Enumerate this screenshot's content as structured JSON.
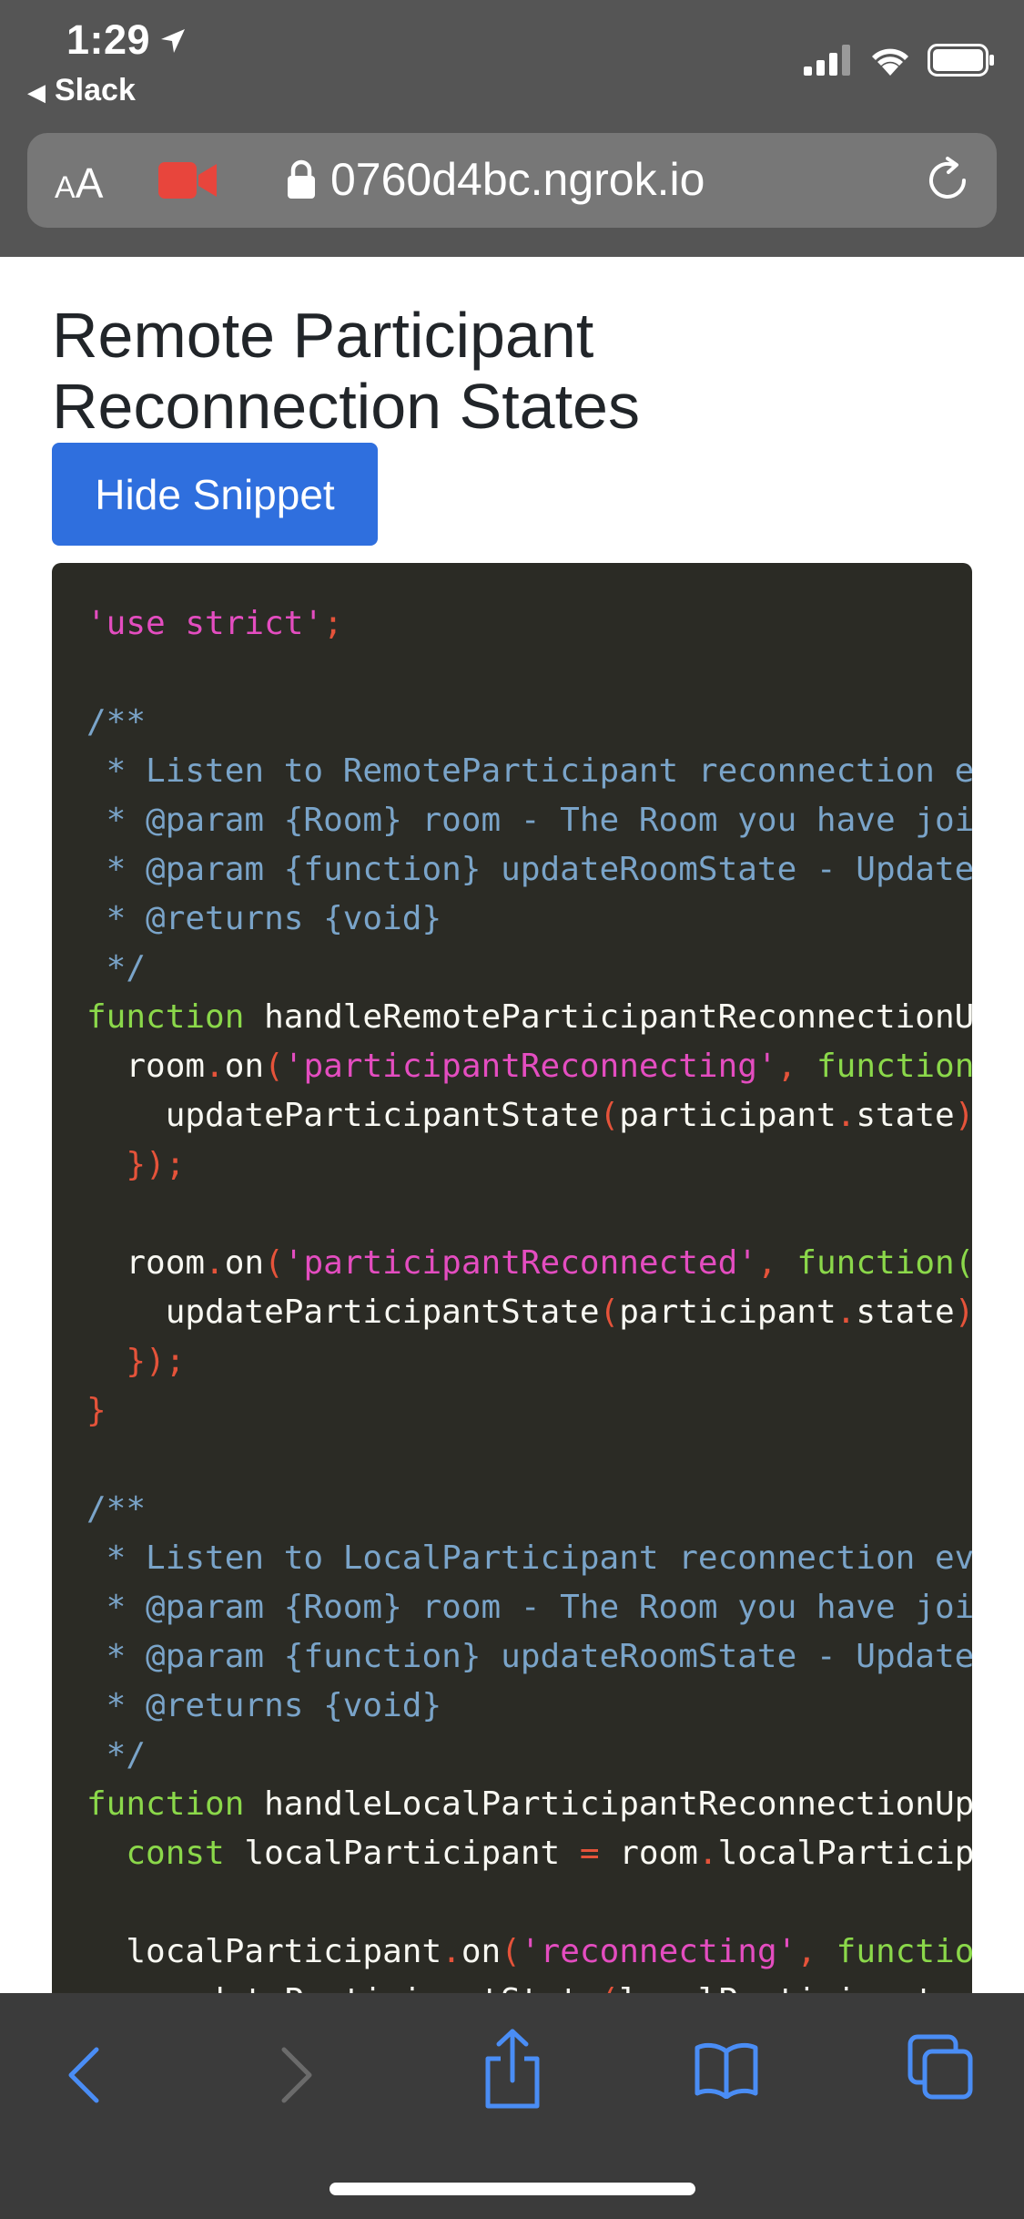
{
  "status_bar": {
    "time": "1:29",
    "back_app": "Slack"
  },
  "browser": {
    "text_size_label_small": "A",
    "text_size_label_big": "A",
    "url": "0760d4bc.ngrok.io"
  },
  "page": {
    "title": "Remote Participant Reconnection States",
    "hide_button": "Hide Snippet"
  },
  "code_lines": [
    [
      {
        "t": "'use strict'",
        "c": "str"
      },
      {
        "t": ";",
        "c": "punc"
      }
    ],
    [],
    [
      {
        "t": "/**",
        "c": "cm"
      }
    ],
    [
      {
        "t": " * Listen to RemoteParticipant reconnection ev",
        "c": "cm"
      }
    ],
    [
      {
        "t": " * @param {Room} room - The Room you have joi",
        "c": "cm"
      }
    ],
    [
      {
        "t": " * @param {function} updateRoomState - Update",
        "c": "cm"
      }
    ],
    [
      {
        "t": " * @returns {void}",
        "c": "cm"
      }
    ],
    [
      {
        "t": " */",
        "c": "cm"
      }
    ],
    [
      {
        "t": "function",
        "c": "kw"
      },
      {
        "t": " handleRemoteParticipantReconnectionU",
        "c": "pl"
      }
    ],
    [
      {
        "t": "  room",
        "c": "pl"
      },
      {
        "t": ".",
        "c": "punc"
      },
      {
        "t": "on",
        "c": "pl"
      },
      {
        "t": "(",
        "c": "punc"
      },
      {
        "t": "'participantReconnecting'",
        "c": "str"
      },
      {
        "t": ", ",
        "c": "punc"
      },
      {
        "t": "function",
        "c": "kw"
      }
    ],
    [
      {
        "t": "    updateParticipantState",
        "c": "pl"
      },
      {
        "t": "(",
        "c": "punc"
      },
      {
        "t": "participant",
        "c": "pl"
      },
      {
        "t": ".",
        "c": "punc"
      },
      {
        "t": "state",
        "c": "pl"
      },
      {
        "t": ")",
        "c": "punc"
      }
    ],
    [
      {
        "t": "  });",
        "c": "punc"
      }
    ],
    [],
    [
      {
        "t": "  room",
        "c": "pl"
      },
      {
        "t": ".",
        "c": "punc"
      },
      {
        "t": "on",
        "c": "pl"
      },
      {
        "t": "(",
        "c": "punc"
      },
      {
        "t": "'participantReconnected'",
        "c": "str"
      },
      {
        "t": ", ",
        "c": "punc"
      },
      {
        "t": "function(",
        "c": "kw"
      }
    ],
    [
      {
        "t": "    updateParticipantState",
        "c": "pl"
      },
      {
        "t": "(",
        "c": "punc"
      },
      {
        "t": "participant",
        "c": "pl"
      },
      {
        "t": ".",
        "c": "punc"
      },
      {
        "t": "state",
        "c": "pl"
      },
      {
        "t": ")",
        "c": "punc"
      }
    ],
    [
      {
        "t": "  });",
        "c": "punc"
      }
    ],
    [
      {
        "t": "}",
        "c": "punc"
      }
    ],
    [],
    [
      {
        "t": "/**",
        "c": "cm"
      }
    ],
    [
      {
        "t": " * Listen to LocalParticipant reconnection ev",
        "c": "cm"
      }
    ],
    [
      {
        "t": " * @param {Room} room - The Room you have joi",
        "c": "cm"
      }
    ],
    [
      {
        "t": " * @param {function} updateRoomState - Update",
        "c": "cm"
      }
    ],
    [
      {
        "t": " * @returns {void}",
        "c": "cm"
      }
    ],
    [
      {
        "t": " */",
        "c": "cm"
      }
    ],
    [
      {
        "t": "function",
        "c": "kw"
      },
      {
        "t": " handleLocalParticipantReconnectionUp",
        "c": "pl"
      }
    ],
    [
      {
        "t": "  ",
        "c": "pl"
      },
      {
        "t": "const",
        "c": "kw"
      },
      {
        "t": " localParticipant ",
        "c": "pl"
      },
      {
        "t": "=",
        "c": "punc"
      },
      {
        "t": " room",
        "c": "pl"
      },
      {
        "t": ".",
        "c": "punc"
      },
      {
        "t": "localParticip",
        "c": "pl"
      }
    ],
    [],
    [
      {
        "t": "  localParticipant",
        "c": "pl"
      },
      {
        "t": ".",
        "c": "punc"
      },
      {
        "t": "on",
        "c": "pl"
      },
      {
        "t": "(",
        "c": "punc"
      },
      {
        "t": "'reconnecting'",
        "c": "str"
      },
      {
        "t": ", ",
        "c": "punc"
      },
      {
        "t": "functio",
        "c": "kw"
      }
    ],
    [
      {
        "t": "    updateParticipantState",
        "c": "pl"
      },
      {
        "t": "(",
        "c": "punc"
      },
      {
        "t": "localParticipant",
        "c": "pl"
      },
      {
        "t": ".",
        "c": "punc"
      },
      {
        "t": "s",
        "c": "pl"
      }
    ]
  ],
  "toolbar": {
    "icons": [
      "back-icon",
      "forward-icon",
      "share-icon",
      "bookmarks-icon",
      "tabs-icon"
    ]
  },
  "colors": {
    "chrome": "#555555",
    "accent": "#2f6fde",
    "code_bg": "#2b2b25",
    "toolbar_icon": "#4a8df5"
  }
}
